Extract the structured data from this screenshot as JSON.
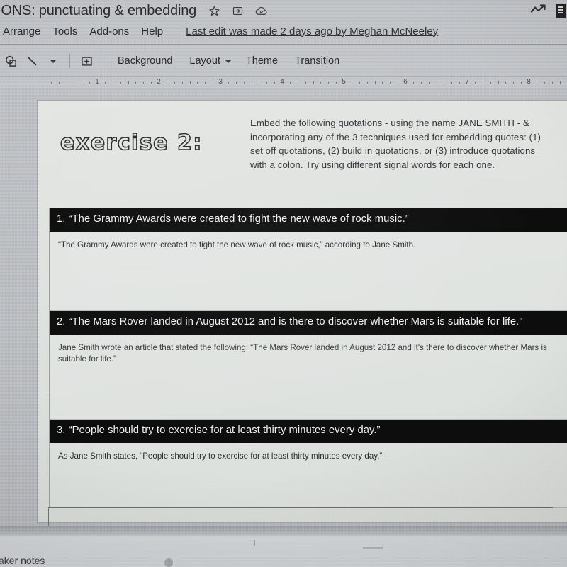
{
  "window": {
    "doc_title": "IONS: punctuating & embedding",
    "title_icons": [
      "star-icon",
      "move-to-folder-icon",
      "cloud-saved-icon"
    ],
    "right_icons": [
      "trending-up-icon",
      "presentation-chip-icon"
    ]
  },
  "menubar": {
    "items": [
      "Arrange",
      "Tools",
      "Add-ons",
      "Help"
    ],
    "last_edit": "Last edit was made 2 days ago by Meghan McNeeley"
  },
  "toolbar": {
    "icons": [
      "shape-icon",
      "line-icon",
      "chevron-down-icon",
      "text-box-icon"
    ],
    "background_label": "Background",
    "layout_label": "Layout",
    "theme_label": "Theme",
    "transition_label": "Transition"
  },
  "ruler": {
    "numbers": [
      "1",
      "2",
      "3",
      "4",
      "5",
      "6",
      "7",
      "8"
    ]
  },
  "slide": {
    "exercise_title": "exercise 2:",
    "instructions": "Embed the following quotations - using the name JANE SMITH - & incorporating any of the 3 techniques used for embedding quotes: (1) set off quotations, (2) build in quotations, or (3) introduce quotations with a colon.  Try using different signal words for each one.",
    "rows": [
      {
        "prompt": "1. “The Grammy Awards were created to fight the new wave of rock music.”",
        "answer": "“The Grammy Awards were created to fight the new wave of rock music,” according to Jane Smith."
      },
      {
        "prompt": "2. “The Mars Rover landed in August 2012 and is there to discover whether Mars is suitable for life.”",
        "answer": "Jane Smith wrote an article that stated the following: “The Mars Rover landed in August 2012 and it's there to discover whether Mars is suitable for life.”"
      },
      {
        "prompt": "3. “People should try to exercise for at least thirty minutes every day.”",
        "answer": "As Jane Smith states, “People should try to exercise for at least thirty minutes every day.”"
      }
    ]
  },
  "bottom": {
    "speaker_notes_label": "aker notes"
  },
  "colors": {
    "header_bar": "#0c0c0c",
    "header_text": "#f2f2f2",
    "slide_bg": "#e0e4e1",
    "chrome_bg": "#c0c3c7",
    "canvas_bg": "#bcbfc3"
  }
}
